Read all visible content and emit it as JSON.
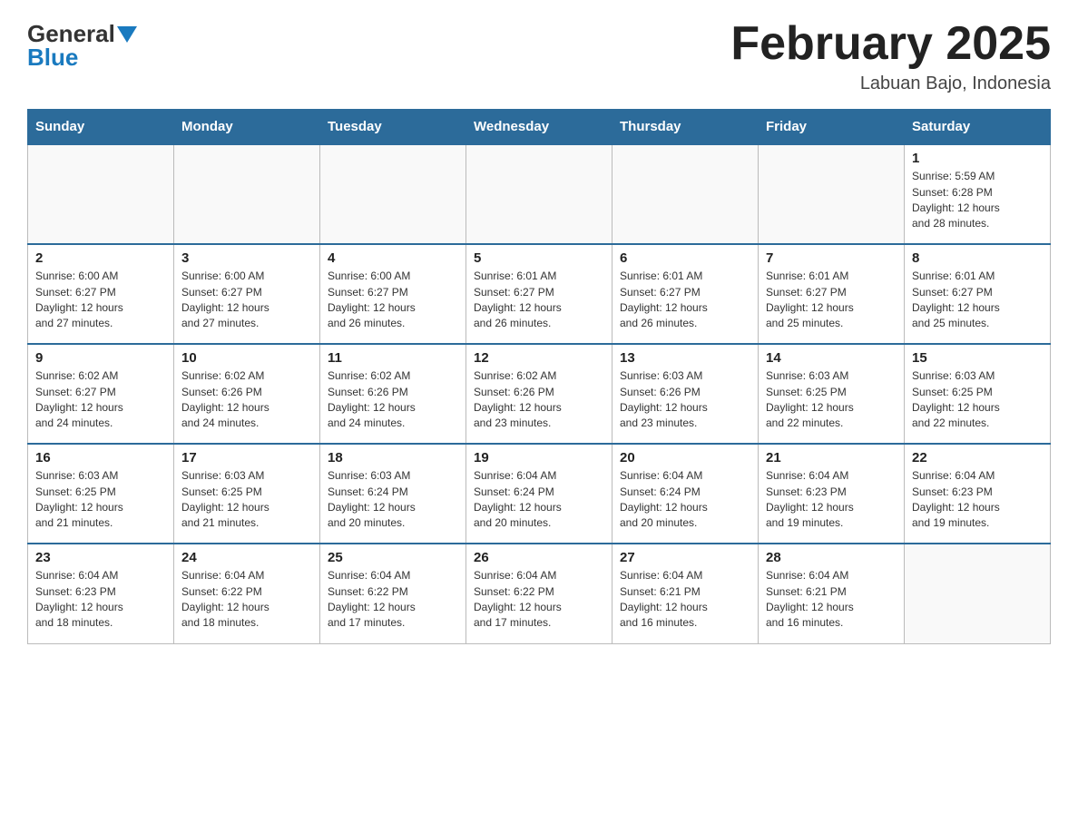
{
  "logo": {
    "general": "General",
    "blue": "Blue"
  },
  "title": "February 2025",
  "location": "Labuan Bajo, Indonesia",
  "days_of_week": [
    "Sunday",
    "Monday",
    "Tuesday",
    "Wednesday",
    "Thursday",
    "Friday",
    "Saturday"
  ],
  "weeks": [
    [
      {
        "day": "",
        "info": ""
      },
      {
        "day": "",
        "info": ""
      },
      {
        "day": "",
        "info": ""
      },
      {
        "day": "",
        "info": ""
      },
      {
        "day": "",
        "info": ""
      },
      {
        "day": "",
        "info": ""
      },
      {
        "day": "1",
        "info": "Sunrise: 5:59 AM\nSunset: 6:28 PM\nDaylight: 12 hours\nand 28 minutes."
      }
    ],
    [
      {
        "day": "2",
        "info": "Sunrise: 6:00 AM\nSunset: 6:27 PM\nDaylight: 12 hours\nand 27 minutes."
      },
      {
        "day": "3",
        "info": "Sunrise: 6:00 AM\nSunset: 6:27 PM\nDaylight: 12 hours\nand 27 minutes."
      },
      {
        "day": "4",
        "info": "Sunrise: 6:00 AM\nSunset: 6:27 PM\nDaylight: 12 hours\nand 26 minutes."
      },
      {
        "day": "5",
        "info": "Sunrise: 6:01 AM\nSunset: 6:27 PM\nDaylight: 12 hours\nand 26 minutes."
      },
      {
        "day": "6",
        "info": "Sunrise: 6:01 AM\nSunset: 6:27 PM\nDaylight: 12 hours\nand 26 minutes."
      },
      {
        "day": "7",
        "info": "Sunrise: 6:01 AM\nSunset: 6:27 PM\nDaylight: 12 hours\nand 25 minutes."
      },
      {
        "day": "8",
        "info": "Sunrise: 6:01 AM\nSunset: 6:27 PM\nDaylight: 12 hours\nand 25 minutes."
      }
    ],
    [
      {
        "day": "9",
        "info": "Sunrise: 6:02 AM\nSunset: 6:27 PM\nDaylight: 12 hours\nand 24 minutes."
      },
      {
        "day": "10",
        "info": "Sunrise: 6:02 AM\nSunset: 6:26 PM\nDaylight: 12 hours\nand 24 minutes."
      },
      {
        "day": "11",
        "info": "Sunrise: 6:02 AM\nSunset: 6:26 PM\nDaylight: 12 hours\nand 24 minutes."
      },
      {
        "day": "12",
        "info": "Sunrise: 6:02 AM\nSunset: 6:26 PM\nDaylight: 12 hours\nand 23 minutes."
      },
      {
        "day": "13",
        "info": "Sunrise: 6:03 AM\nSunset: 6:26 PM\nDaylight: 12 hours\nand 23 minutes."
      },
      {
        "day": "14",
        "info": "Sunrise: 6:03 AM\nSunset: 6:25 PM\nDaylight: 12 hours\nand 22 minutes."
      },
      {
        "day": "15",
        "info": "Sunrise: 6:03 AM\nSunset: 6:25 PM\nDaylight: 12 hours\nand 22 minutes."
      }
    ],
    [
      {
        "day": "16",
        "info": "Sunrise: 6:03 AM\nSunset: 6:25 PM\nDaylight: 12 hours\nand 21 minutes."
      },
      {
        "day": "17",
        "info": "Sunrise: 6:03 AM\nSunset: 6:25 PM\nDaylight: 12 hours\nand 21 minutes."
      },
      {
        "day": "18",
        "info": "Sunrise: 6:03 AM\nSunset: 6:24 PM\nDaylight: 12 hours\nand 20 minutes."
      },
      {
        "day": "19",
        "info": "Sunrise: 6:04 AM\nSunset: 6:24 PM\nDaylight: 12 hours\nand 20 minutes."
      },
      {
        "day": "20",
        "info": "Sunrise: 6:04 AM\nSunset: 6:24 PM\nDaylight: 12 hours\nand 20 minutes."
      },
      {
        "day": "21",
        "info": "Sunrise: 6:04 AM\nSunset: 6:23 PM\nDaylight: 12 hours\nand 19 minutes."
      },
      {
        "day": "22",
        "info": "Sunrise: 6:04 AM\nSunset: 6:23 PM\nDaylight: 12 hours\nand 19 minutes."
      }
    ],
    [
      {
        "day": "23",
        "info": "Sunrise: 6:04 AM\nSunset: 6:23 PM\nDaylight: 12 hours\nand 18 minutes."
      },
      {
        "day": "24",
        "info": "Sunrise: 6:04 AM\nSunset: 6:22 PM\nDaylight: 12 hours\nand 18 minutes."
      },
      {
        "day": "25",
        "info": "Sunrise: 6:04 AM\nSunset: 6:22 PM\nDaylight: 12 hours\nand 17 minutes."
      },
      {
        "day": "26",
        "info": "Sunrise: 6:04 AM\nSunset: 6:22 PM\nDaylight: 12 hours\nand 17 minutes."
      },
      {
        "day": "27",
        "info": "Sunrise: 6:04 AM\nSunset: 6:21 PM\nDaylight: 12 hours\nand 16 minutes."
      },
      {
        "day": "28",
        "info": "Sunrise: 6:04 AM\nSunset: 6:21 PM\nDaylight: 12 hours\nand 16 minutes."
      },
      {
        "day": "",
        "info": ""
      }
    ]
  ]
}
